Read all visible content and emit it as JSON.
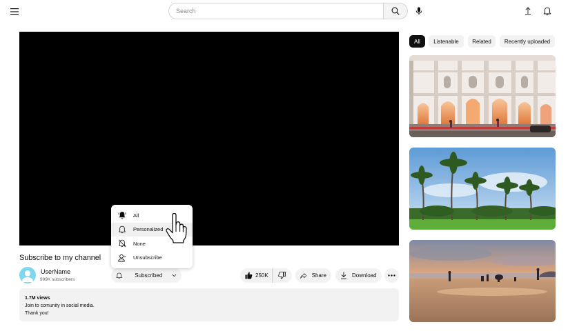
{
  "header": {
    "search_placeholder": "Search",
    "icons": [
      "menu-icon",
      "search-icon",
      "mic-icon",
      "upload-icon",
      "bell-icon"
    ]
  },
  "video": {
    "title": "Subscribe to my channel",
    "channel_name": "UserName",
    "subscribers": "999K subscribers",
    "subscribed_label": "Subscribed",
    "likes": "250K",
    "share_label": "Share",
    "download_label": "Download"
  },
  "description": {
    "views": "1.7M views",
    "line1": "Join to comunity in social media.",
    "line2": "Thank you!"
  },
  "notification_menu": {
    "items": [
      {
        "label": "All",
        "icon": "bell-filled-icon"
      },
      {
        "label": "Personalized",
        "icon": "bell-outline-icon"
      },
      {
        "label": "None",
        "icon": "bell-off-icon"
      },
      {
        "label": "Unsubscribe",
        "icon": "person-remove-icon"
      }
    ]
  },
  "chips": [
    "All",
    "Listenable",
    "Related",
    "Recently uploaded"
  ],
  "active_chip": "All",
  "thumbnails": [
    {
      "subject": "white colonial building"
    },
    {
      "subject": "palm trees under blue sky"
    },
    {
      "subject": "beach at sunset"
    }
  ],
  "colors": {
    "accent_dark": "#0f0f0f",
    "pill_bg": "#f2f2f2",
    "avatar": "#7fd7ee",
    "player_bg": "#000000"
  }
}
